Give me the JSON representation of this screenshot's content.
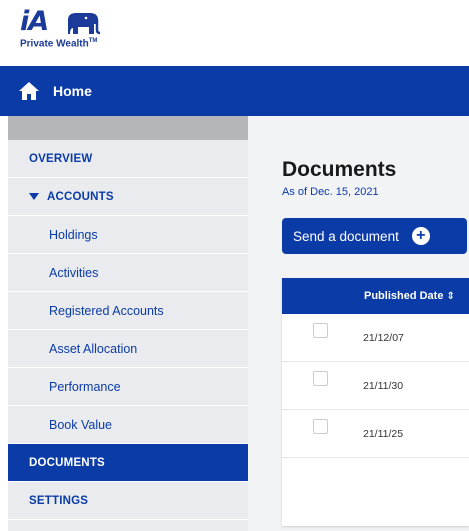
{
  "brand": {
    "logo_text": "iA",
    "tagline": "Private Wealth",
    "trademark": "TM",
    "color": "#1b3a9a"
  },
  "homebar": {
    "label": "Home",
    "icon": "home-icon",
    "color": "#0b3ba7"
  },
  "sidebar": {
    "items": [
      {
        "label": "OVERVIEW",
        "level": "top",
        "active": false
      },
      {
        "label": "ACCOUNTS",
        "level": "top",
        "expanded": true,
        "active": false
      },
      {
        "label": "Holdings",
        "level": "sub",
        "active": false
      },
      {
        "label": "Activities",
        "level": "sub",
        "active": false
      },
      {
        "label": "Registered Accounts",
        "level": "sub",
        "active": false
      },
      {
        "label": "Asset Allocation",
        "level": "sub",
        "active": false
      },
      {
        "label": "Performance",
        "level": "sub",
        "active": false
      },
      {
        "label": "Book Value",
        "level": "sub",
        "active": false
      },
      {
        "label": "DOCUMENTS",
        "level": "top",
        "active": true
      },
      {
        "label": "SETTINGS",
        "level": "top",
        "active": false
      }
    ]
  },
  "main": {
    "title": "Documents",
    "as_of": "As of Dec. 15, 2021",
    "send_button": "Send a document",
    "table": {
      "columns": [
        "Published Date"
      ],
      "sort_icon": "sort-icon",
      "rows": [
        {
          "date": "21/12/07",
          "checked": false
        },
        {
          "date": "21/11/30",
          "checked": false
        },
        {
          "date": "21/11/25",
          "checked": false
        }
      ]
    }
  }
}
